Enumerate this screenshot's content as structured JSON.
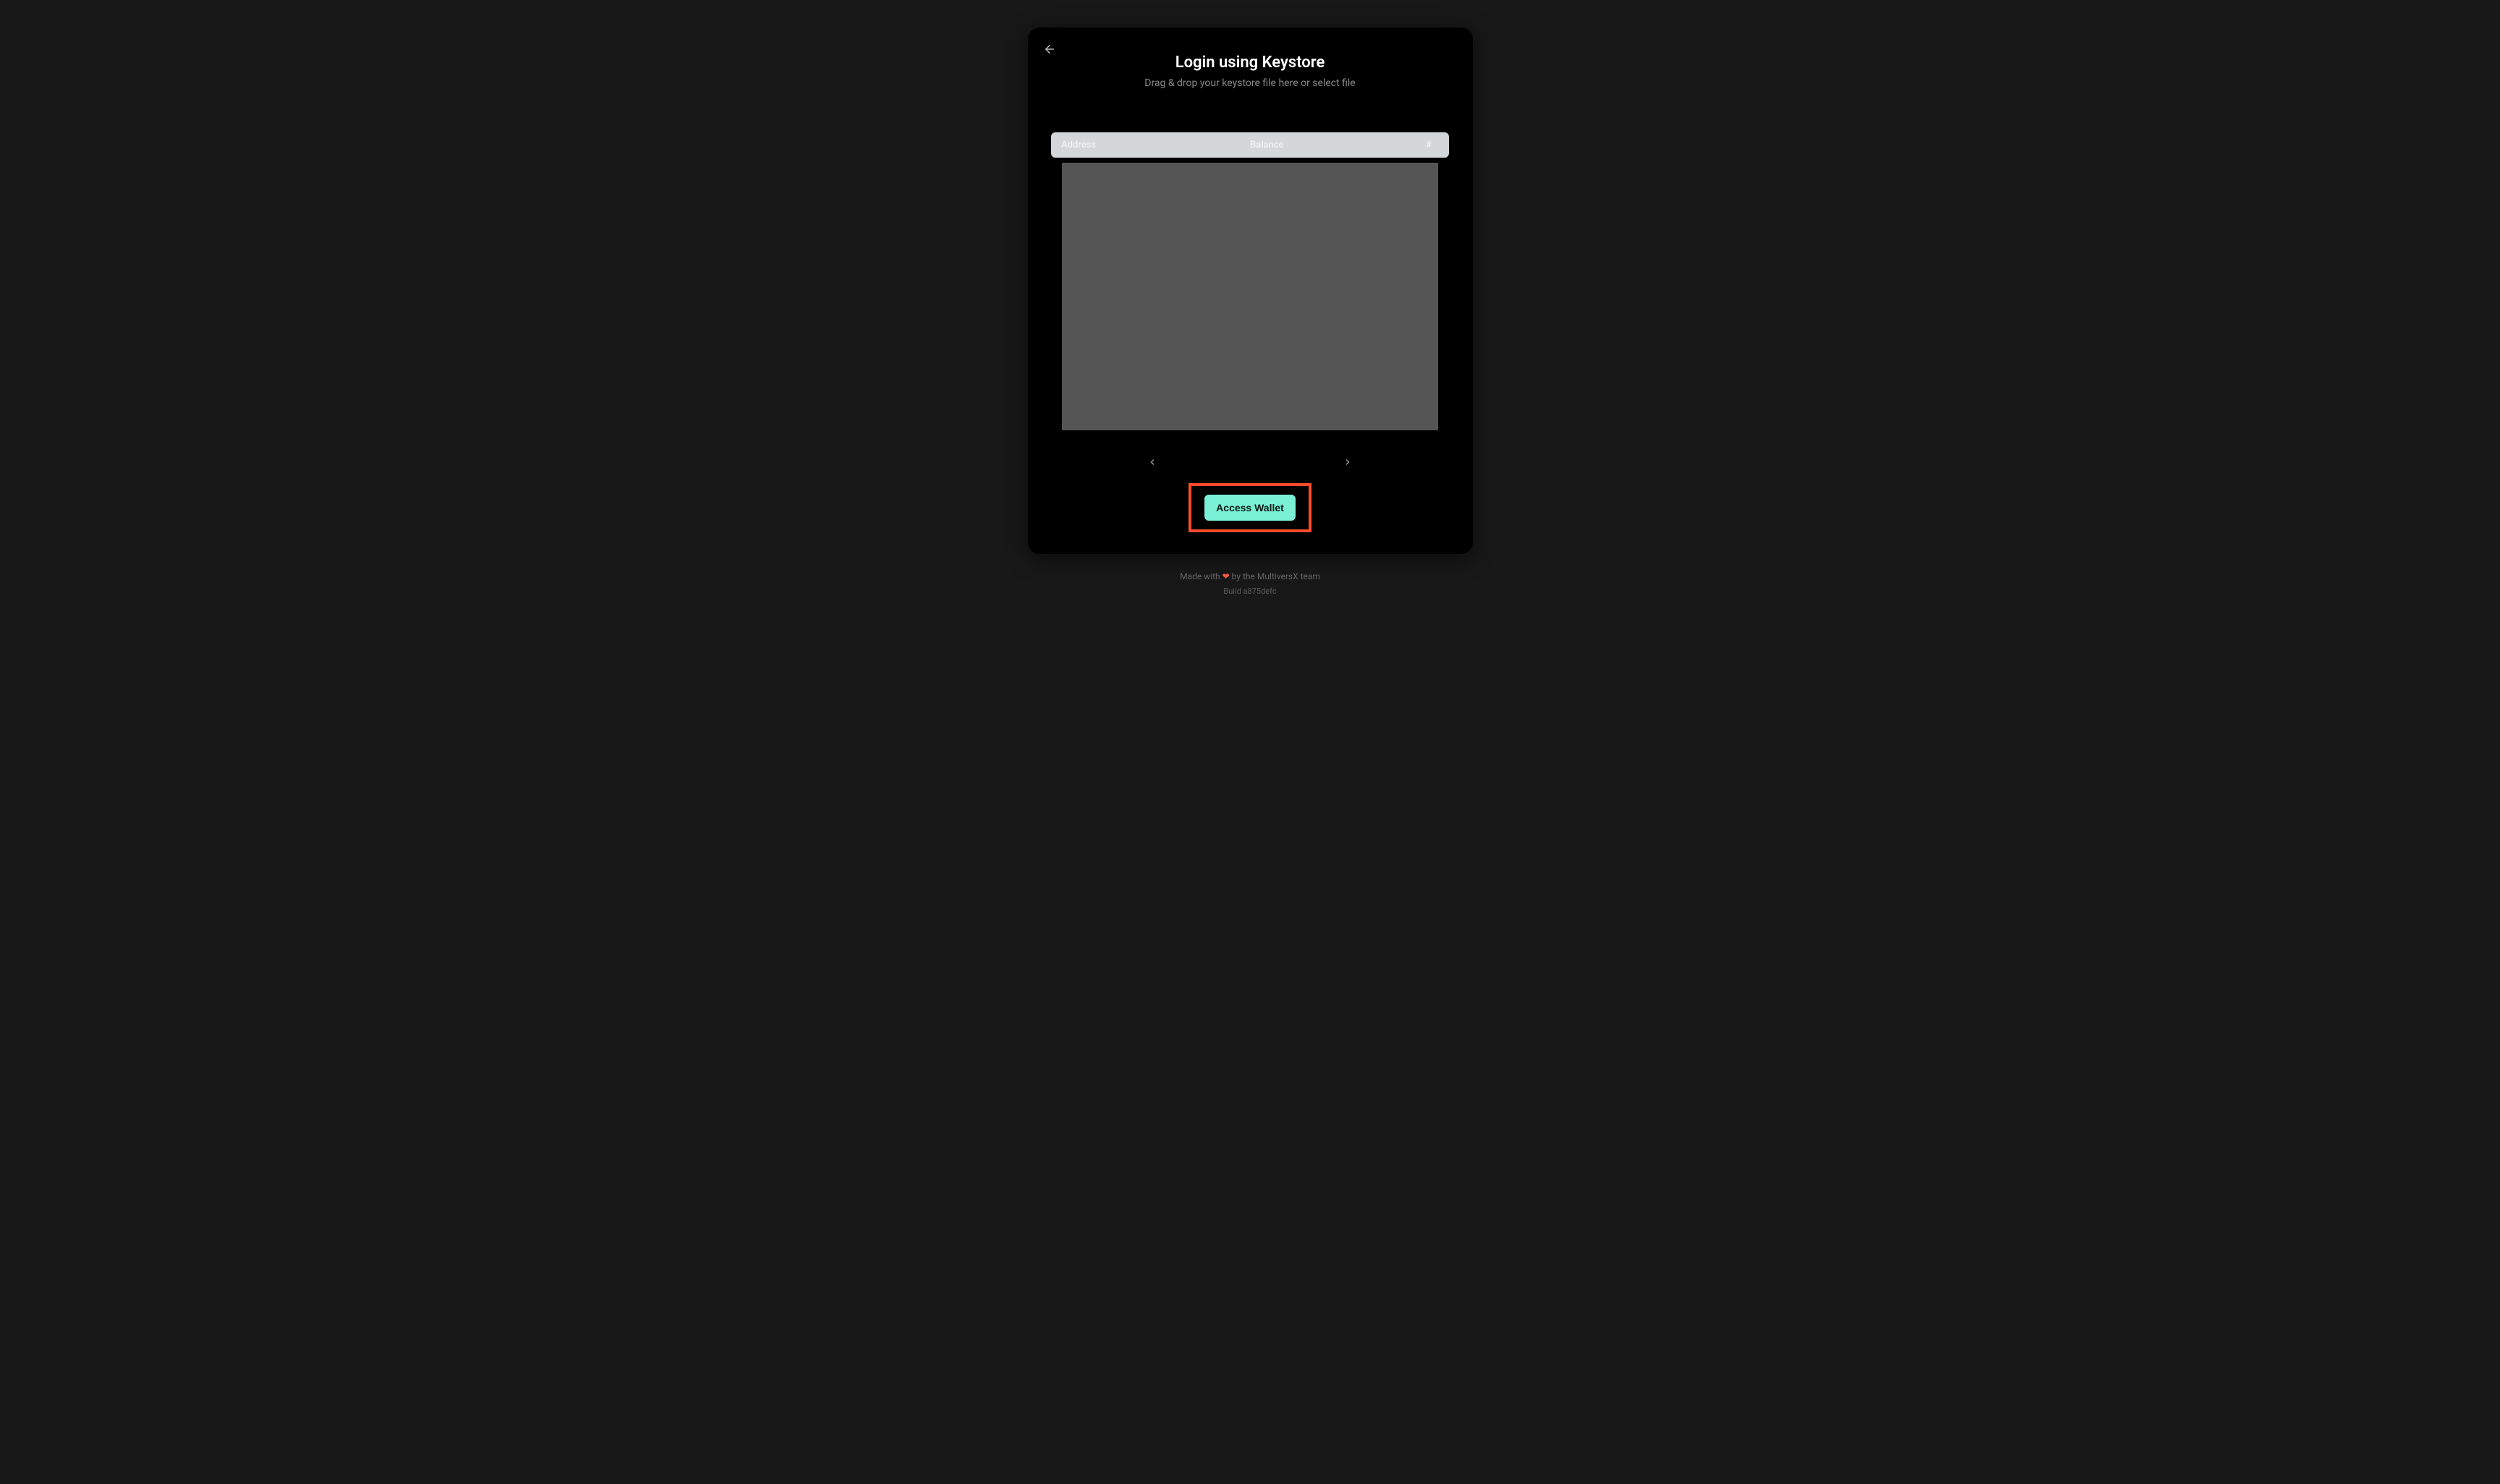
{
  "modal": {
    "title": "Login using Keystore",
    "subtitle": "Drag & drop your keystore file here or select file",
    "columns": {
      "address": "Address",
      "balance": "Balance",
      "hash": "#"
    },
    "access_label": "Access Wallet"
  },
  "footer": {
    "prefix": "Made with ",
    "heart": "❤",
    "suffix": " by the MultiversX team",
    "build_prefix": "Build ",
    "build_hash": "a875defc"
  },
  "colors": {
    "accent": "#7af0d5",
    "highlight_border": "#ff4b2b",
    "modal_bg": "#000000",
    "page_bg": "#181818"
  }
}
